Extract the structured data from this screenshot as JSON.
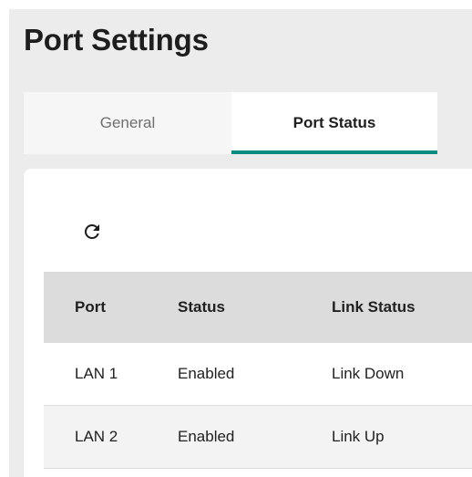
{
  "page": {
    "title": "Port Settings"
  },
  "tabs": [
    {
      "label": "General",
      "active": false
    },
    {
      "label": "Port Status",
      "active": true
    }
  ],
  "toolbar": {
    "refresh_icon": "refresh-icon"
  },
  "table": {
    "columns": [
      "Port",
      "Status",
      "Link Status"
    ],
    "rows": [
      [
        "LAN 1",
        "Enabled",
        "Link Down"
      ],
      [
        "LAN 2",
        "Enabled",
        "Link Up"
      ]
    ]
  },
  "colors": {
    "accent": "#0b8a7e",
    "background": "#ececec",
    "header_row": "#dcdcdc"
  }
}
